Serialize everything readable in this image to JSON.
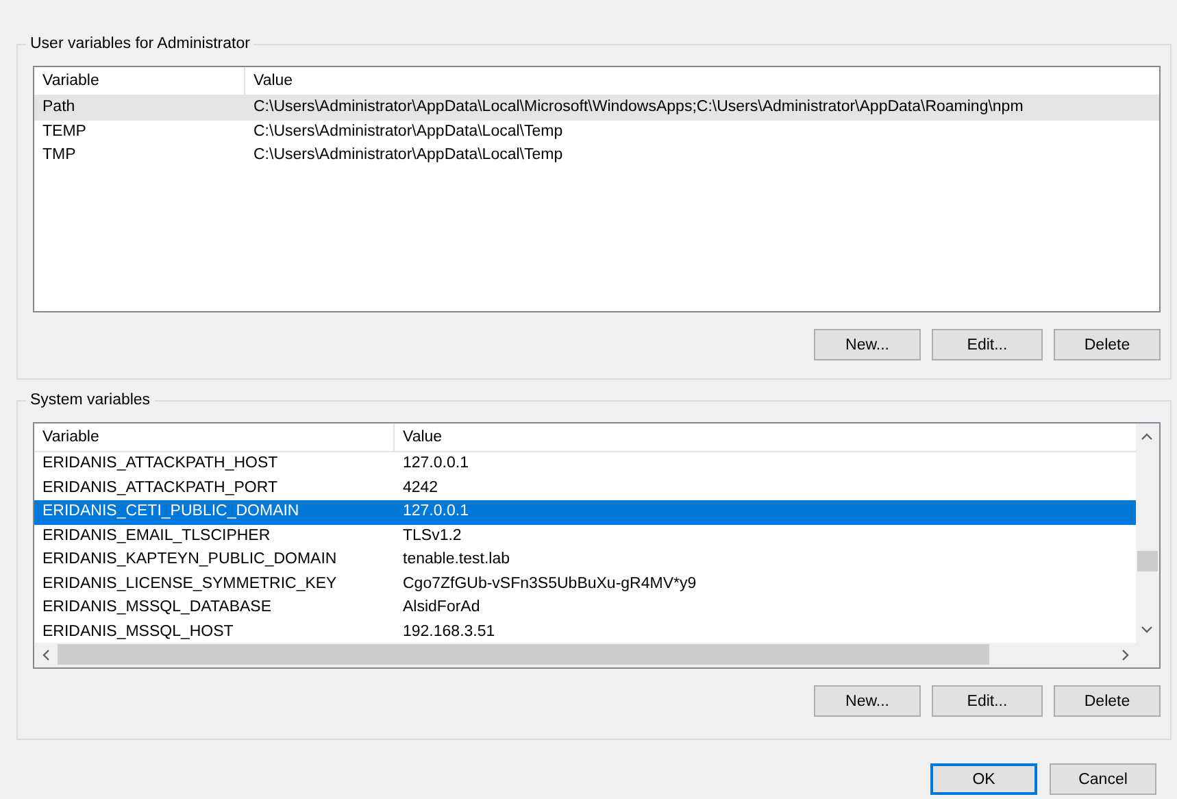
{
  "user_variables": {
    "title": "User variables for Administrator",
    "focused": false,
    "columns": [
      "Variable",
      "Value"
    ],
    "rows": [
      {
        "variable": "Path",
        "value": "C:\\Users\\Administrator\\AppData\\Local\\Microsoft\\WindowsApps;C:\\Users\\Administrator\\AppData\\Roaming\\npm",
        "selected": true
      },
      {
        "variable": "TEMP",
        "value": "C:\\Users\\Administrator\\AppData\\Local\\Temp",
        "selected": false
      },
      {
        "variable": "TMP",
        "value": "C:\\Users\\Administrator\\AppData\\Local\\Temp",
        "selected": false
      }
    ],
    "buttons": [
      "New...",
      "Edit...",
      "Delete"
    ]
  },
  "system_variables": {
    "title": "System variables",
    "focused": true,
    "columns": [
      "Variable",
      "Value"
    ],
    "rows": [
      {
        "variable": "ERIDANIS_ATTACKPATH_HOST",
        "value": "127.0.0.1",
        "selected": false
      },
      {
        "variable": "ERIDANIS_ATTACKPATH_PORT",
        "value": "4242",
        "selected": false
      },
      {
        "variable": "ERIDANIS_CETI_PUBLIC_DOMAIN",
        "value": "127.0.0.1",
        "selected": true
      },
      {
        "variable": "ERIDANIS_EMAIL_TLSCIPHER",
        "value": "TLSv1.2",
        "selected": false
      },
      {
        "variable": "ERIDANIS_KAPTEYN_PUBLIC_DOMAIN",
        "value": "tenable.test.lab",
        "selected": false
      },
      {
        "variable": "ERIDANIS_LICENSE_SYMMETRIC_KEY",
        "value": "Cgo7ZfGUb-vSFn3S5UbBuXu-gR4MV*y9",
        "selected": false
      },
      {
        "variable": "ERIDANIS_MSSQL_DATABASE",
        "value": "AlsidForAd",
        "selected": false
      },
      {
        "variable": "ERIDANIS_MSSQL_HOST",
        "value": "192.168.3.51",
        "selected": false
      }
    ],
    "buttons": [
      "New...",
      "Edit...",
      "Delete"
    ]
  },
  "dialog_buttons": [
    {
      "label": "OK",
      "default": true
    },
    {
      "label": "Cancel",
      "default": false
    }
  ]
}
